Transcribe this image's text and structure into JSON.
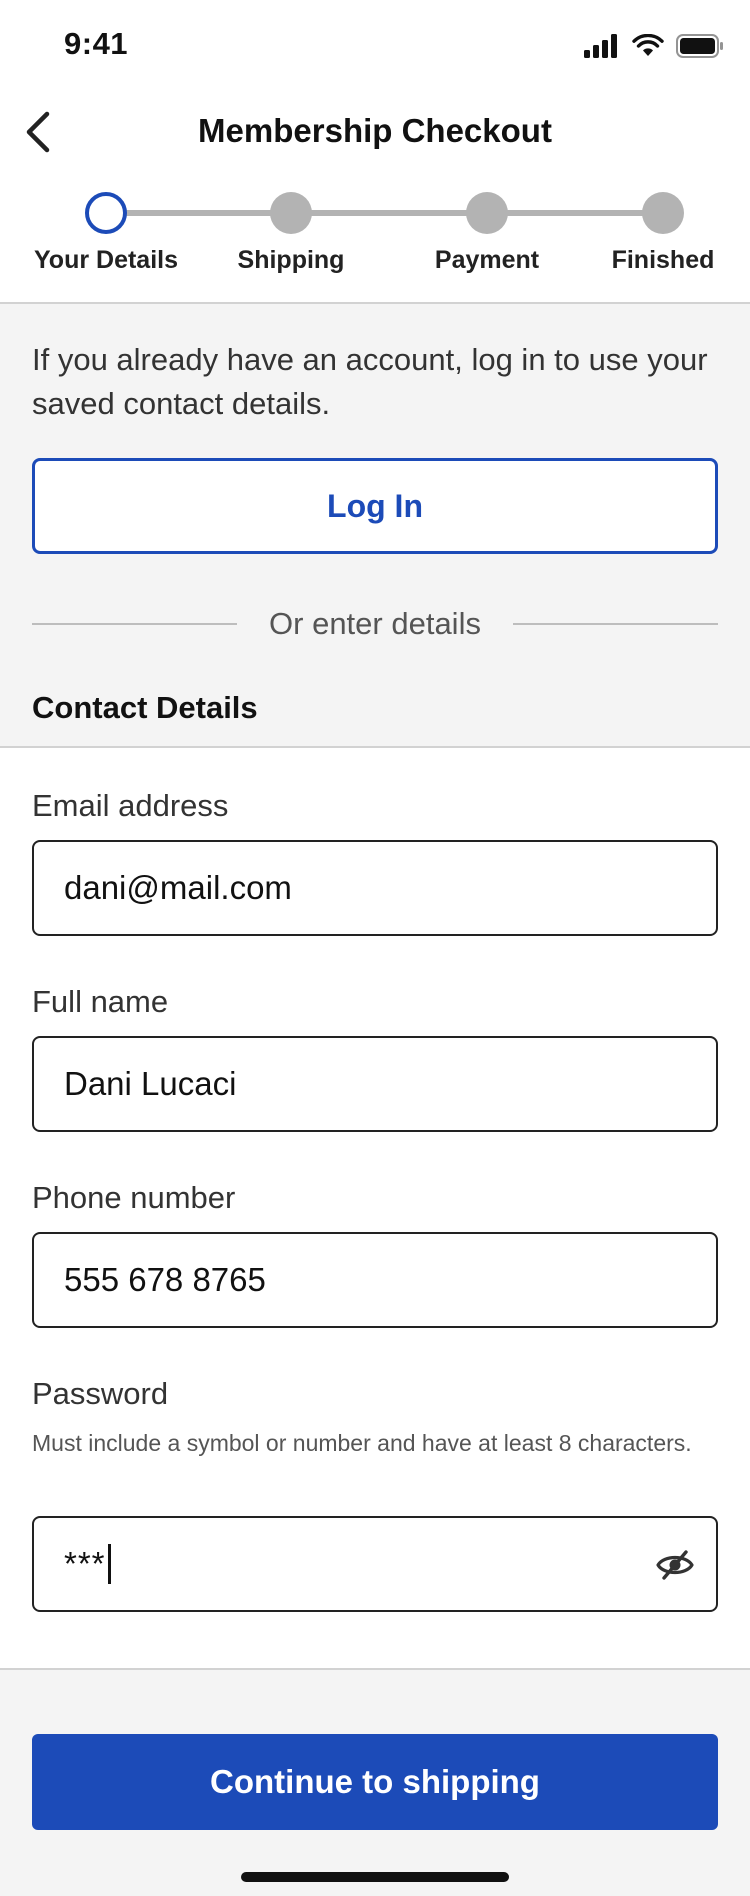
{
  "status_bar": {
    "time": "9:41"
  },
  "header": {
    "title": "Membership Checkout"
  },
  "stepper": {
    "steps": [
      {
        "label": "Your Details",
        "state": "current"
      },
      {
        "label": "Shipping",
        "state": "upcoming"
      },
      {
        "label": "Payment",
        "state": "upcoming"
      },
      {
        "label": "Finished",
        "state": "upcoming"
      }
    ]
  },
  "login_section": {
    "intro": "If you already have an account, log in to use your saved contact details.",
    "login_label": "Log In",
    "divider_text": "Or enter details",
    "heading": "Contact Details"
  },
  "form": {
    "email": {
      "label": "Email address",
      "value": "dani@mail.com"
    },
    "full_name": {
      "label": "Full name",
      "value": "Dani Lucaci"
    },
    "phone": {
      "label": "Phone number",
      "value": "555 678 8765"
    },
    "password": {
      "label": "Password",
      "hint": "Must include a symbol or number and have at least 8 characters.",
      "masked_value": "***"
    }
  },
  "footer": {
    "continue_label": "Continue to shipping"
  },
  "colors": {
    "primary": "#1c4bb8",
    "inactive_step": "#b3b3b3",
    "section_bg": "#f4f4f4"
  },
  "icons": [
    "back-chevron-icon",
    "signal-icon",
    "wifi-icon",
    "battery-icon",
    "eye-slash-icon"
  ]
}
